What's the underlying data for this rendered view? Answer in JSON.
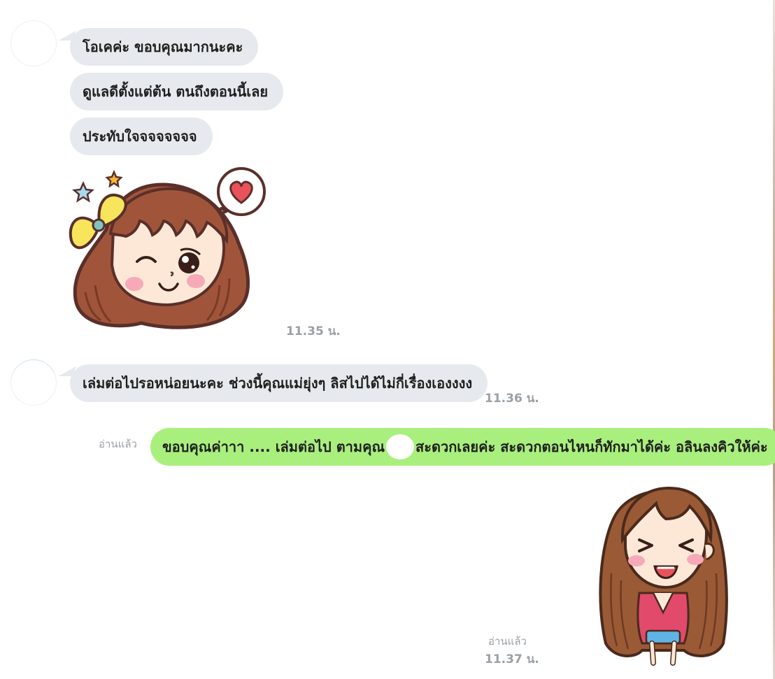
{
  "conversation": {
    "incoming_group_1": {
      "messages": [
        "โอเคค่ะ ขอบคุณมากนะคะ",
        "ดูแลดีตั้งแต่ต้น ตนถึงตอนนี้เลย",
        "ประทับใจจจจจจจจ"
      ],
      "sticker": "wink-girl-bow-heart-sticker",
      "time": "11.35 น."
    },
    "incoming_group_2": {
      "message": "เล่มต่อไปรอหน่อยนะคะ ช่วงนี้คุณแม่ยุ่งๆ ลิสไปได้ไม่กี่เรื่องเองงงง",
      "time": "11.36 น."
    },
    "outgoing_group": {
      "read_label": "อ่านแล้ว",
      "message_part_1": "ขอบคุณค่าาา .... เล่มต่อไป ตามคุณ",
      "message_part_2": "สะดวกเลยค่ะ สะดวกตอนไหนก็ทักมาได้ค่ะ อลินลงคิวให้ค่ะ",
      "sticker": "laughing-girl-long-hair-sticker",
      "sticker_read_label": "อ่านแล้ว",
      "time": "11.37 น."
    }
  },
  "colors": {
    "incoming_bubble": "#e6eaee",
    "outgoing_bubble": "#a9ef7d",
    "timestamp": "#9aa0a6"
  }
}
